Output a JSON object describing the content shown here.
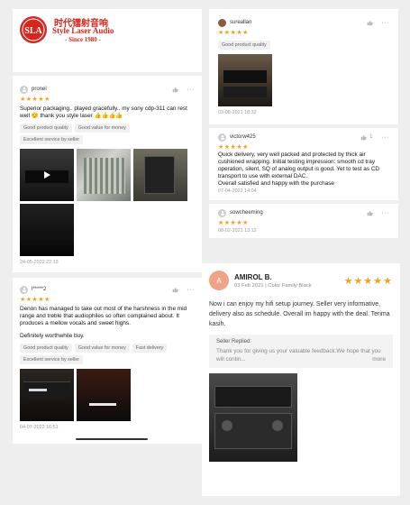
{
  "brand": {
    "logo_chinese": "时代镭射音响",
    "logo_name": "Style Laser Audio",
    "logo_since": "- Since 1980 -",
    "brand_color": "#d7261e"
  },
  "reviews_left": [
    {
      "user": "pronel",
      "rating": 5,
      "text": "Superior packaging.. played gracefully.. my sony cdp-311 can rest well 😌 thank you style laser 👍👍👍👍",
      "tags": [
        "Good product quality",
        "Good value for money",
        "Excellent service by seller"
      ],
      "date": "24-05-2022 22:13"
    },
    {
      "user": "l*****2",
      "rating": 5,
      "text": "Denon has managed to take out most of the harshness in the mid range and treble that audiophiles so often complained about. It produces a mellow vocals and sweet highs.",
      "text2": "Definitely worthwhile buy.",
      "tags": [
        "Good product quality",
        "Good value for money",
        "Fast delivery",
        "Excellent service by seller"
      ],
      "date": "04-07-2022 16:51"
    }
  ],
  "reviews_right": [
    {
      "user": "sureallan",
      "rating": 5,
      "tags": [
        "Good product quality"
      ],
      "date": "03-08-2021 18:32"
    },
    {
      "user": "victorw425",
      "rating": 5,
      "likes": "1",
      "text": "Quick delivery, very well packed and protected by thick air cushioned wrapping. Initial testing impression: smooth cd tray operation, silent, SQ of analog output is good. Yet to test as CD transport to use with external DAC.",
      "text2": "Overall satisfied and happy with the purchase",
      "date": "07-04-2022 14:04"
    },
    {
      "user": "sowcheeming",
      "rating": 5,
      "date": "08-02-2021 13:12"
    }
  ],
  "amirol": {
    "initial": "A",
    "name": "AMIROL B.",
    "meta": "03 Feb 2021 | Color Family:Black",
    "rating": 5,
    "text": "Now i can enjoy my hifi setup journey. Seller very informative, delivery also as schedule. Overall im happy with the deal. Terima kasih.",
    "reply_title": "Seller Replied:",
    "reply_text": "Thank you for giving us your valuable feedback.We hope that you will contin...",
    "reply_more": "more"
  }
}
